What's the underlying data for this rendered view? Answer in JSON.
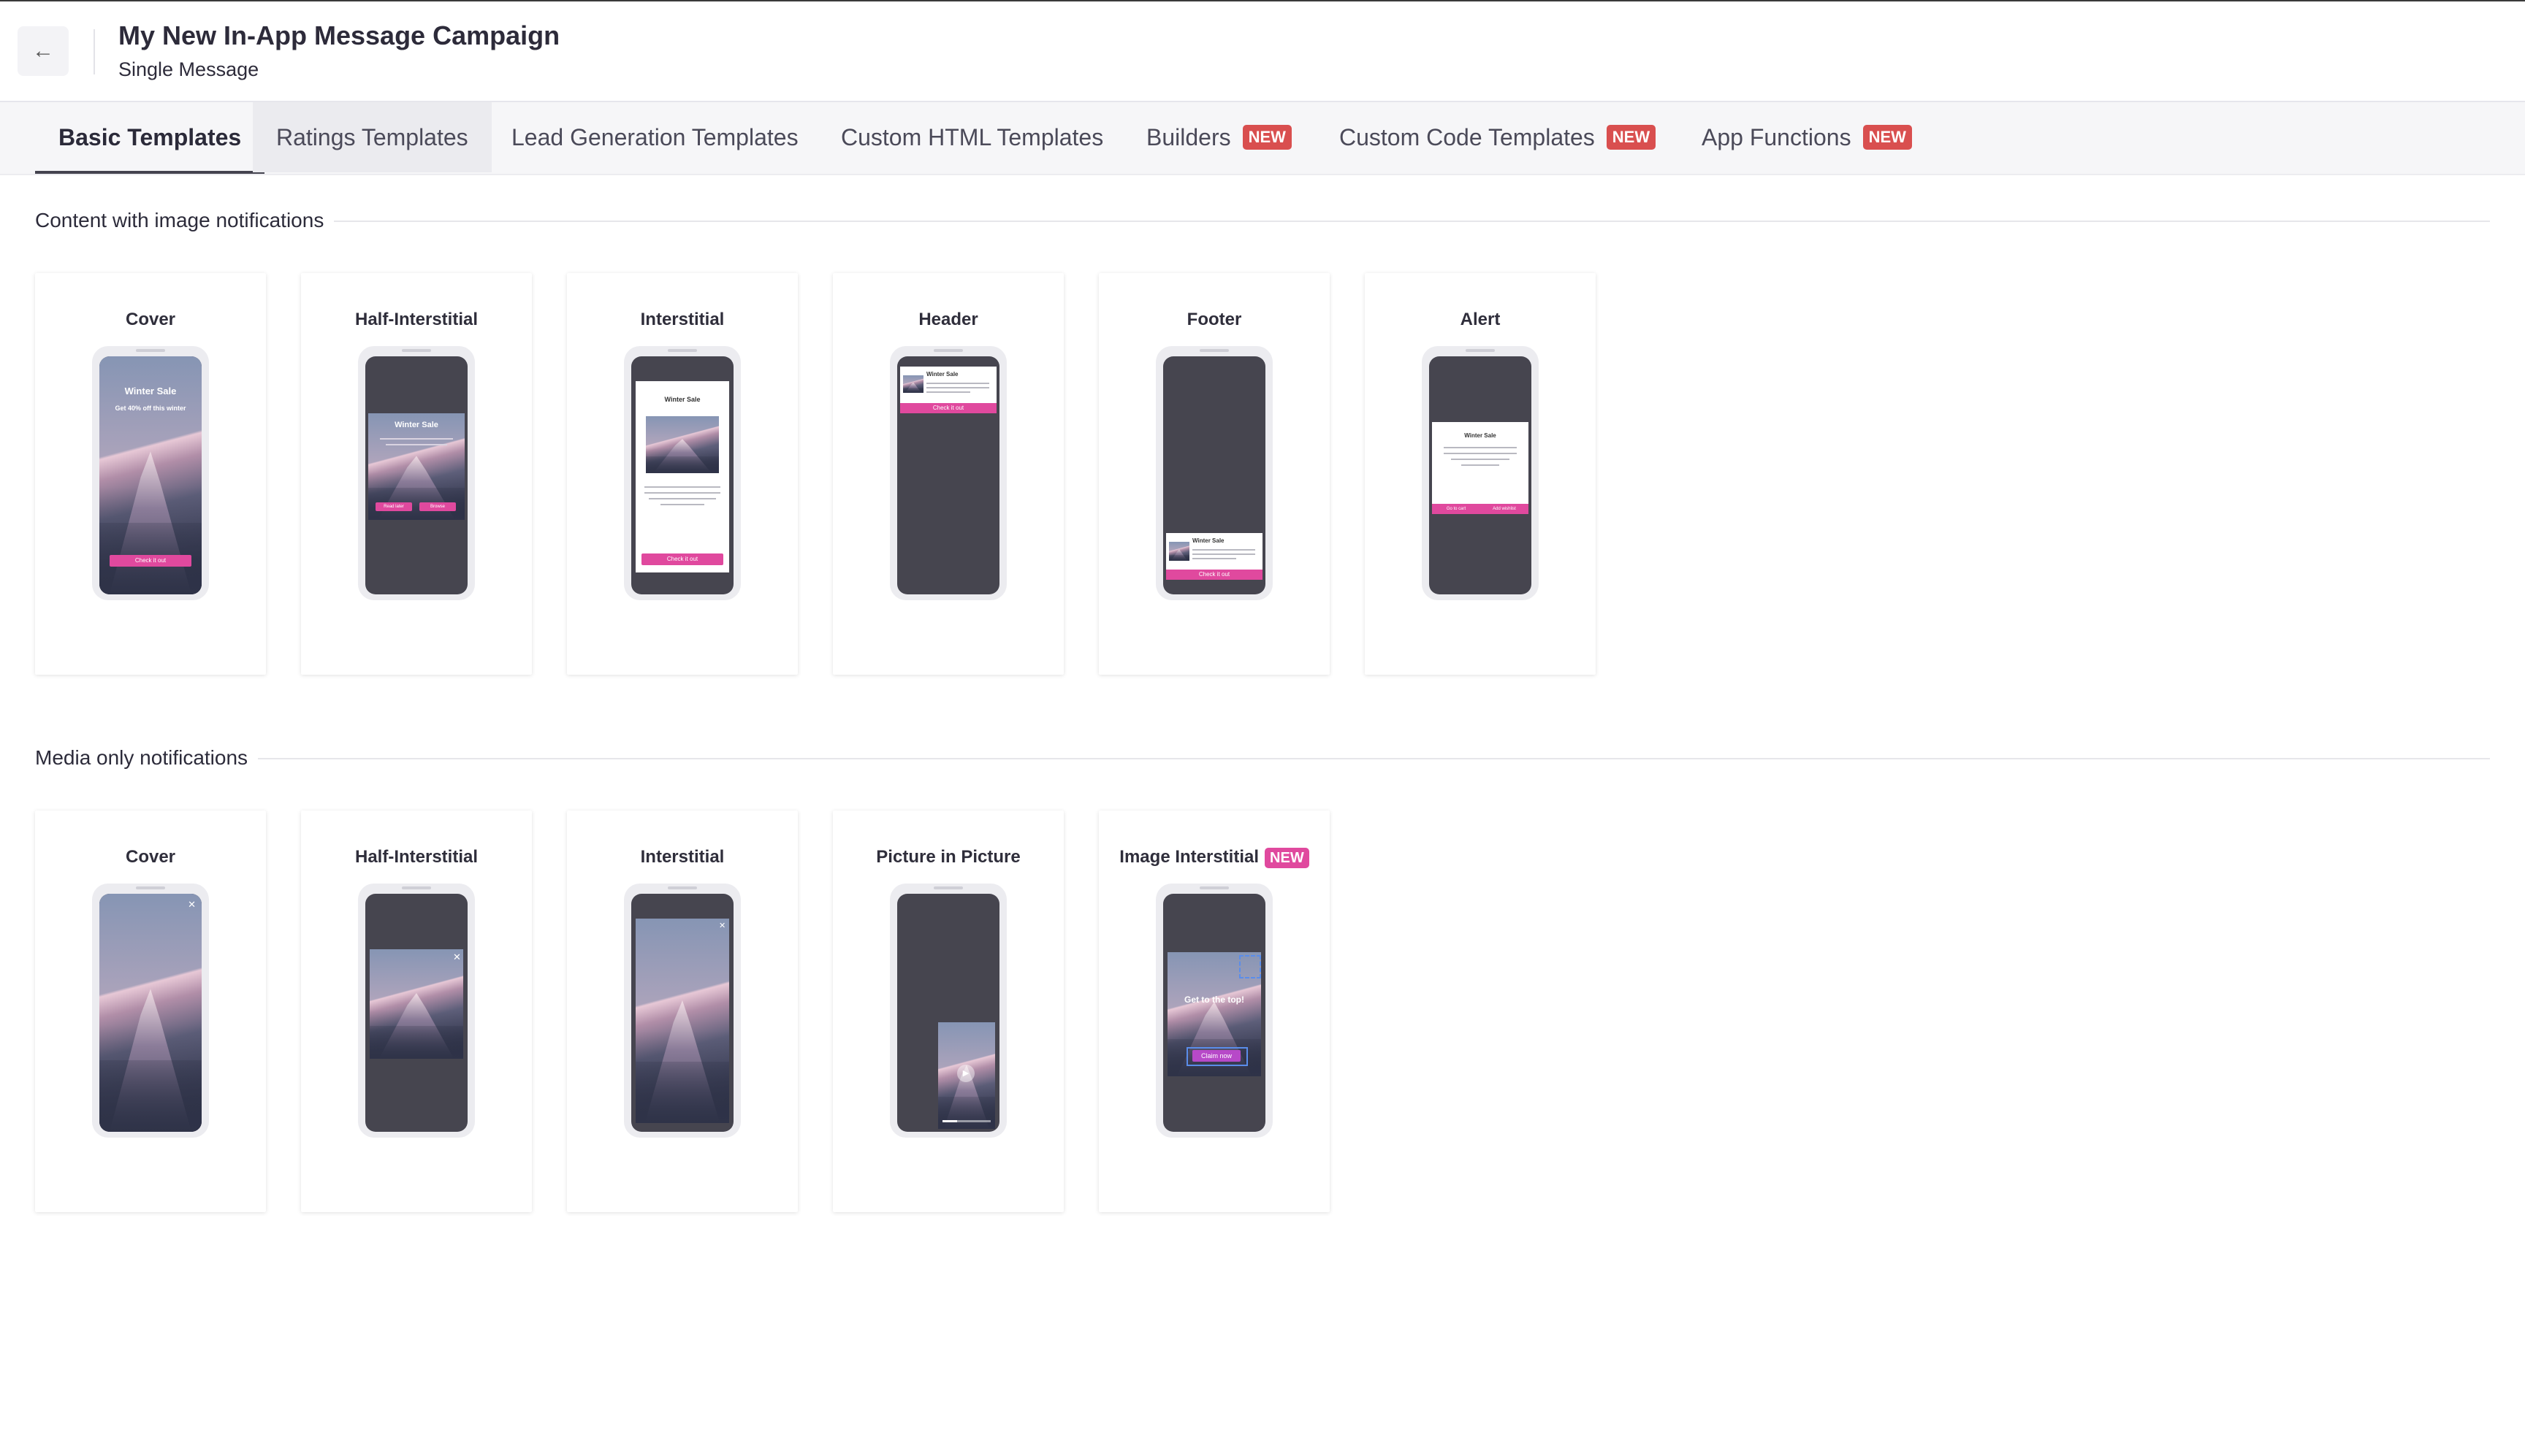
{
  "header": {
    "back_icon": "arrow-left-icon",
    "title": "My New In-App Message Campaign",
    "subtitle": "Single Message"
  },
  "tabs": [
    {
      "label": "Basic Templates",
      "active": true
    },
    {
      "label": "Ratings Templates"
    },
    {
      "label": "Lead Generation Templates"
    },
    {
      "label": "Custom HTML Templates"
    },
    {
      "label": "Builders",
      "badge": "NEW"
    },
    {
      "label": "Custom Code Templates",
      "badge": "NEW"
    },
    {
      "label": "App Functions",
      "badge": "NEW"
    }
  ],
  "sections": {
    "content": {
      "title": "Content with image notifications",
      "cards": [
        {
          "label": "Cover",
          "heading": "Winter Sale",
          "subheading": "Get 40% off this winter",
          "button": "Check it out"
        },
        {
          "label": "Half-Interstitial",
          "heading": "Winter Sale",
          "buttons": [
            "Read later",
            "Browse"
          ]
        },
        {
          "label": "Interstitial",
          "heading": "Winter Sale",
          "button": "Check it out"
        },
        {
          "label": "Header",
          "heading": "Winter Sale",
          "button": "Check it out"
        },
        {
          "label": "Footer",
          "heading": "Winter Sale",
          "button": "Check it out"
        },
        {
          "label": "Alert",
          "heading": "Winter Sale",
          "buttons": [
            "Go to cart",
            "Add wishlist"
          ]
        }
      ]
    },
    "media": {
      "title": "Media only notifications",
      "cards": [
        {
          "label": "Cover"
        },
        {
          "label": "Half-Interstitial"
        },
        {
          "label": "Interstitial"
        },
        {
          "label": "Picture in Picture"
        },
        {
          "label": "Image Interstitial",
          "badge": "NEW",
          "heading": "Get to the top!",
          "button": "Claim now"
        }
      ]
    }
  },
  "colors": {
    "accent_pink": "#e0499e",
    "badge_red": "#d94f4f",
    "phone_screen": "#46454f"
  }
}
